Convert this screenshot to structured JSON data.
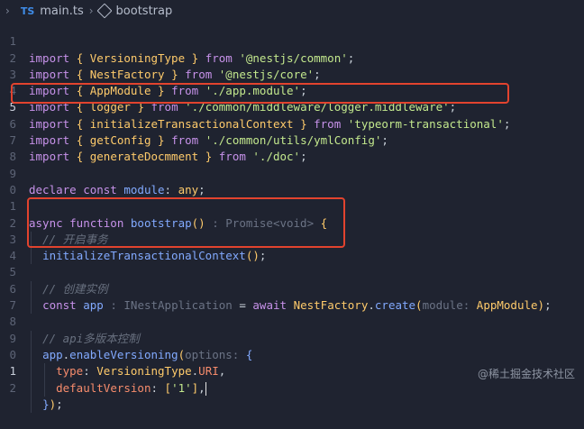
{
  "breadcrumb": {
    "file": "main.ts",
    "file_icon": "TS",
    "symbol": "bootstrap"
  },
  "lines": {
    "l1": {
      "num": "1",
      "import_kw": "import",
      "name": "VersioningType",
      "from_kw": "from",
      "path": "'@nestjs/common'"
    },
    "l2": {
      "num": "2",
      "import_kw": "import",
      "name": "NestFactory",
      "from_kw": "from",
      "path": "'@nestjs/core'"
    },
    "l3": {
      "num": "3",
      "import_kw": "import",
      "name": "AppModule",
      "from_kw": "from",
      "path": "'./app.module'"
    },
    "l4": {
      "num": "4",
      "import_kw": "import",
      "name": "logger",
      "from_kw": "from",
      "path": "'./common/middleware/logger.middleware'"
    },
    "l5": {
      "num": "5",
      "import_kw": "import",
      "name": "initializeTransactionalContext",
      "from_kw": "from",
      "path": "'typeorm-transactional'"
    },
    "l6": {
      "num": "6",
      "import_kw": "import",
      "name": "getConfig",
      "from_kw": "from",
      "path": "'./common/utils/ymlConfig'"
    },
    "l7": {
      "num": "7",
      "import_kw": "import",
      "name": "generateDocmment",
      "from_kw": "from",
      "path": "'./doc'"
    },
    "l8": {
      "num": "8"
    },
    "l9": {
      "num": "9",
      "declare_kw": "declare const",
      "ident": "module",
      "type": "any"
    },
    "l10": {
      "num": "0"
    },
    "l11": {
      "num": "1",
      "async_kw": "async function",
      "fn_name": "bootstrap",
      "return_hint": ": Promise<void>"
    },
    "l12": {
      "num": "2",
      "comment": "// 开启事务"
    },
    "l13": {
      "num": "3",
      "call": "initializeTransactionalContext"
    },
    "l14": {
      "num": "4"
    },
    "l15": {
      "num": "5",
      "comment": "// 创建实例"
    },
    "l16": {
      "num": "6",
      "const_kw": "const",
      "ident": "app",
      "type_hint": ": INestApplication",
      "await_kw": "await",
      "obj": "NestFactory",
      "method": "create",
      "param_hint": "module:",
      "arg": "AppModule"
    },
    "l17": {
      "num": "7"
    },
    "l18": {
      "num": "8",
      "comment": "// api多版本控制"
    },
    "l19": {
      "num": "9",
      "obj": "app",
      "method": "enableVersioning",
      "param_hint": "options:"
    },
    "l20": {
      "num": "0",
      "key": "type",
      "obj": "VersioningType",
      "prop": "URI"
    },
    "l21": {
      "num": "1",
      "key": "defaultVersion",
      "value": "'1'"
    },
    "l22": {
      "num": "2"
    }
  },
  "watermark": "@稀土掘金技术社区"
}
